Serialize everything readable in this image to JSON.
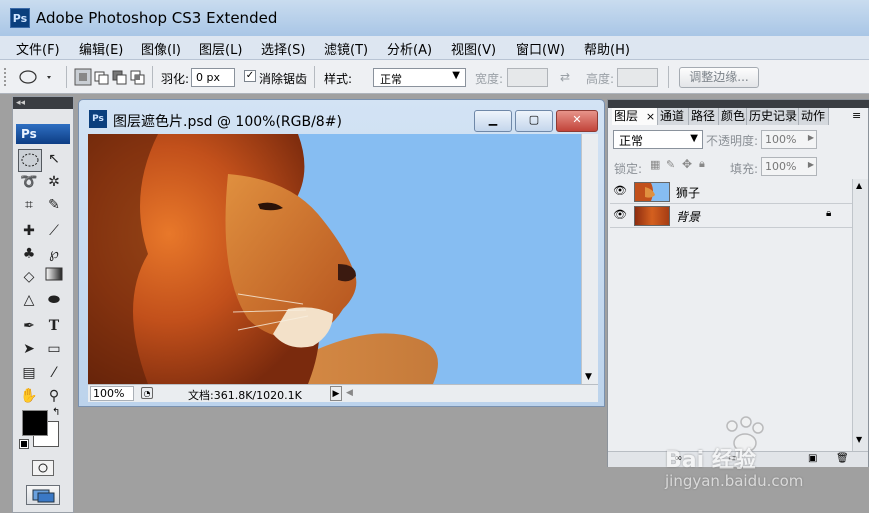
{
  "window": {
    "app_icon": "Ps",
    "title": "Adobe Photoshop CS3 Extended"
  },
  "menu": [
    "文件(F)",
    "编辑(E)",
    "图像(I)",
    "图层(L)",
    "选择(S)",
    "滤镜(T)",
    "分析(A)",
    "视图(V)",
    "窗口(W)",
    "帮助(H)"
  ],
  "options_bar": {
    "feather_label": "羽化:",
    "feather_value": "0 px",
    "antialias_label": "消除锯齿",
    "antialias_checked": true,
    "style_label": "样式:",
    "style_value": "正常",
    "width_label": "宽度:",
    "height_label": "高度:",
    "refine_edge_label": "调整边缘..."
  },
  "tools": {
    "panel_header": "◂◂",
    "logo": "Ps"
  },
  "document": {
    "icon": "Ps",
    "title": "图层遮色片.psd @ 100%(RGB/8#)",
    "minimize_label": "▁",
    "maximize_label": "▢",
    "close_label": "✕",
    "zoom": "100%",
    "doc_info": "文档:361.8K/1020.1K"
  },
  "layers_panel": {
    "tabs": [
      "图层",
      "通道",
      "路径",
      "颜色",
      "历史记录",
      "动作"
    ],
    "tab_close": "×",
    "blend_mode": "正常",
    "opacity_label": "不透明度:",
    "opacity_value": "100%",
    "lock_label": "锁定:",
    "fill_label": "填充:",
    "fill_value": "100%",
    "layers": [
      {
        "name": "狮子",
        "visible": true
      },
      {
        "name": "背景",
        "visible": true,
        "locked": true
      }
    ]
  },
  "watermark": {
    "brand": "Bai 经验",
    "url": "jingyan.baidu.com"
  },
  "colors": {
    "canvas_sky": "#86bdf2",
    "workspace": "#a0a0a0",
    "foreground": "#000000",
    "background": "#ffffff"
  }
}
